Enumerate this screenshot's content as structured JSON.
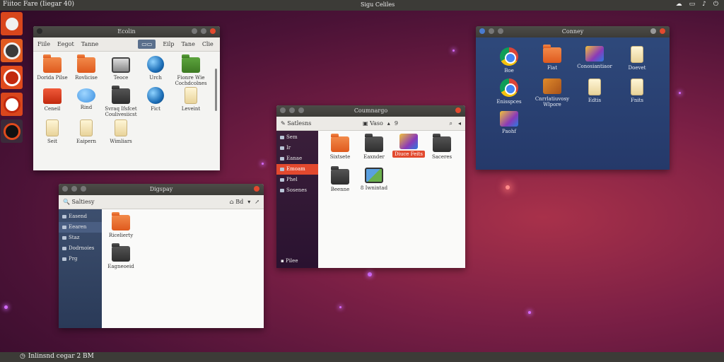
{
  "topbar": {
    "app_title": "Fiitoc Fare (Iiegar 40)",
    "clock": "Sigu Celiles"
  },
  "bottombar": {
    "status": "Inlinsnd cegar 2 BM"
  },
  "launcher": {
    "items": [
      "ubuntu",
      "firefox",
      "software-center",
      "terminal",
      "settings"
    ]
  },
  "win1": {
    "title": "Ecolin",
    "toolbar": [
      "Fiile",
      "Eegot",
      "Tanne",
      "Eilp",
      "Tane",
      "Clie"
    ],
    "items": [
      {
        "label": "Dorida Pilse",
        "icon": "folder-orange"
      },
      {
        "label": "Rovlicise",
        "icon": "folder-orange"
      },
      {
        "label": "Teoce",
        "icon": "camera"
      },
      {
        "label": "Urch",
        "icon": "globe"
      },
      {
        "label": "Fionre Wie Cochdcolnes",
        "icon": "folder-green"
      },
      {
        "label": "Ceneil",
        "icon": "redbox"
      },
      {
        "label": "Rind",
        "icon": "pill"
      },
      {
        "label": "Svraq Ifsfcet Coulivesiicst",
        "icon": "folder-dark"
      },
      {
        "label": "Fict",
        "icon": "globe"
      },
      {
        "label": "Leveint",
        "icon": "doc"
      },
      {
        "label": "Seit",
        "icon": "doc"
      },
      {
        "label": "Eaipern",
        "icon": "doc"
      },
      {
        "label": "Wimliars",
        "icon": "doc"
      }
    ]
  },
  "win2": {
    "title": "Digspay",
    "location": "Bd",
    "sidebar": [
      "Easend",
      "Eearen",
      "Staz",
      "Dodrnoies",
      "Prg"
    ],
    "active": 1,
    "crumb": "Saltiesy",
    "items": [
      {
        "label": "Ricelierty",
        "icon": "folder-orange"
      },
      {
        "label": "Eagneoeid",
        "icon": "folder-dark"
      }
    ]
  },
  "win3": {
    "title": "Coumnargo",
    "location": "Vaso",
    "location_suffix": "9",
    "crumb": "Satlesns",
    "sidebar": [
      "Sem",
      "Ir",
      "Eanae",
      "Emoam",
      "Phel",
      "Sosenes"
    ],
    "active": 3,
    "foot": "Pilee",
    "items": [
      {
        "label": "Sixtsete",
        "icon": "folder-orange"
      },
      {
        "label": "Eaxnder",
        "icon": "folder-dark"
      },
      {
        "label": "Diuce Feits",
        "icon": "palette"
      },
      {
        "label": "Saceres",
        "icon": "folder-dark"
      },
      {
        "label": "Beenne",
        "icon": "folder-dark"
      },
      {
        "label": "8 Iwnintad",
        "icon": "tiles"
      }
    ]
  },
  "win4": {
    "title": "Conney",
    "items": [
      {
        "label": "Boe",
        "icon": "chrome"
      },
      {
        "label": "Fiat",
        "icon": "folder-orange"
      },
      {
        "label": "Conosiantiaor",
        "icon": "palette"
      },
      {
        "label": "Doevet",
        "icon": "doc"
      },
      {
        "label": "Enisspces",
        "icon": "chrome"
      },
      {
        "label": "Cnrrlatiuvosy Wlpore",
        "icon": "cubes"
      },
      {
        "label": "Edtis",
        "icon": "doc"
      },
      {
        "label": "Fnits",
        "icon": "doc"
      },
      {
        "label": "Paohf",
        "icon": "palette"
      }
    ]
  }
}
